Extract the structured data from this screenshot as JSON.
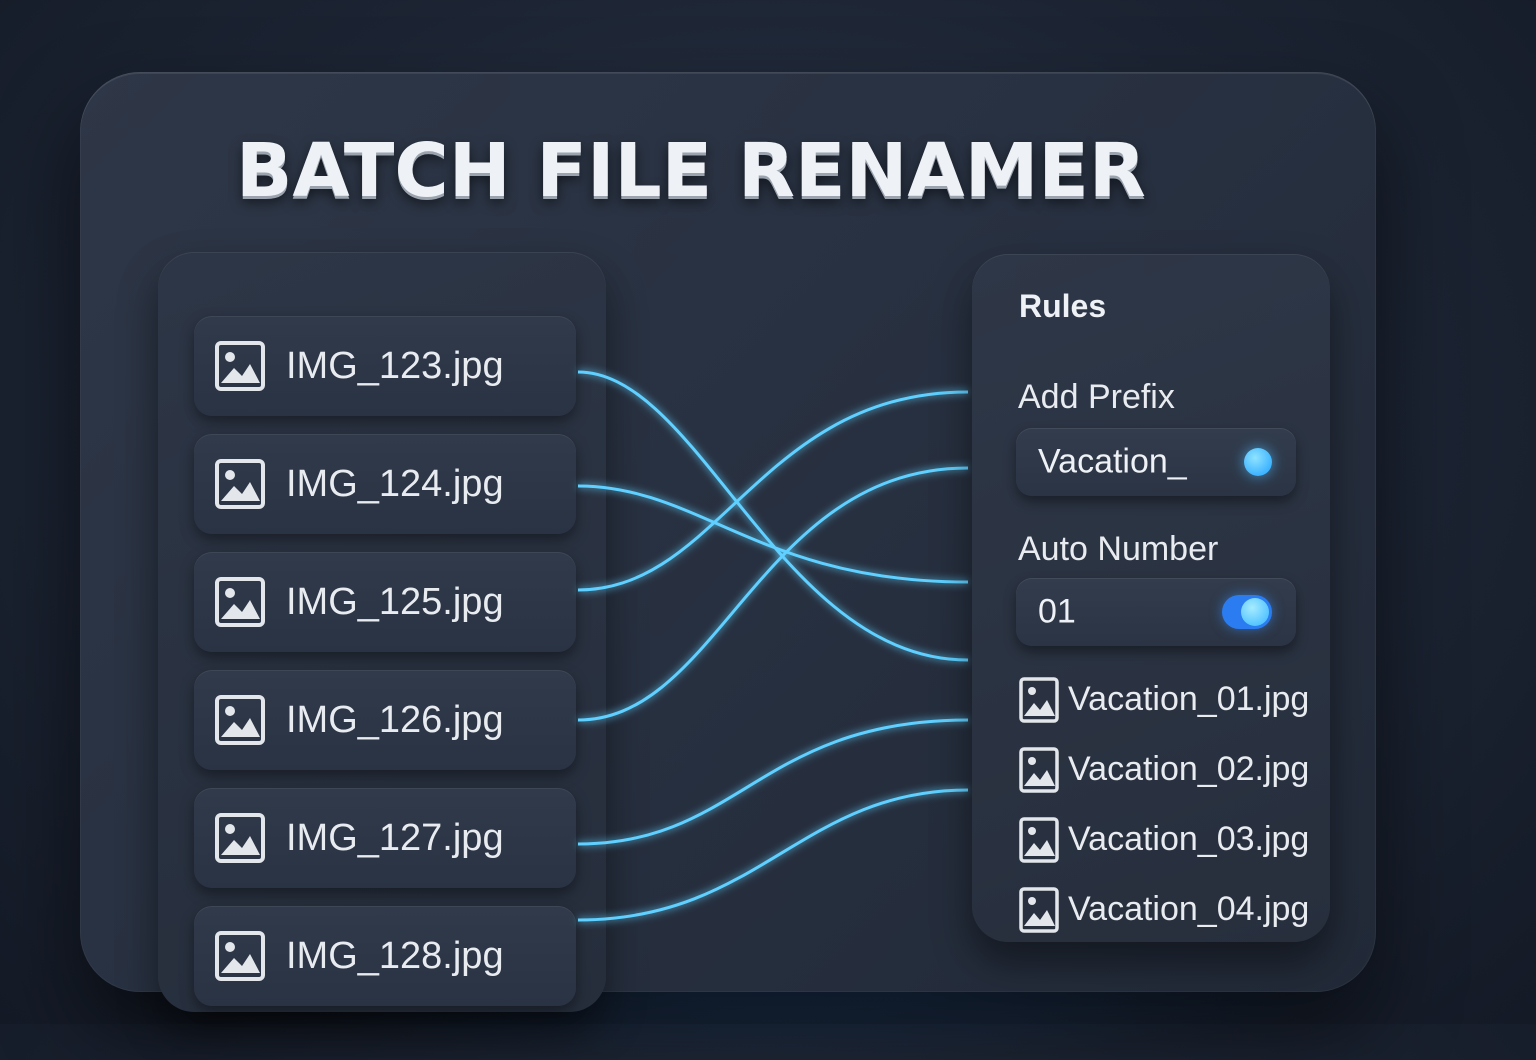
{
  "app": {
    "title": "BATCH FILE RENAMER"
  },
  "source_files": [
    {
      "name": "IMG_123.jpg",
      "icon": "image-icon"
    },
    {
      "name": "IMG_124.jpg",
      "icon": "image-icon"
    },
    {
      "name": "IMG_125.jpg",
      "icon": "image-icon"
    },
    {
      "name": "IMG_126.jpg",
      "icon": "image-icon"
    },
    {
      "name": "IMG_127.jpg",
      "icon": "image-icon"
    },
    {
      "name": "IMG_128.jpg",
      "icon": "image-icon"
    }
  ],
  "rules": {
    "heading": "Rules",
    "add_prefix": {
      "label": "Add Prefix",
      "value": "Vacation_",
      "enabled": true
    },
    "auto_number": {
      "label": "Auto Number",
      "value": "01",
      "enabled": true
    }
  },
  "output_files": [
    {
      "name": "Vacation_01.jpg",
      "icon": "image-icon"
    },
    {
      "name": "Vacation_02.jpg",
      "icon": "image-icon"
    },
    {
      "name": "Vacation_03.jpg",
      "icon": "image-icon"
    },
    {
      "name": "Vacation_04.jpg",
      "icon": "image-icon"
    }
  ],
  "colors": {
    "accent": "#3fb4ff",
    "toggle_on": "#2a7cf0",
    "connector": "#5fd0ff",
    "background": "#1c2433",
    "panel": "#2a3343"
  }
}
